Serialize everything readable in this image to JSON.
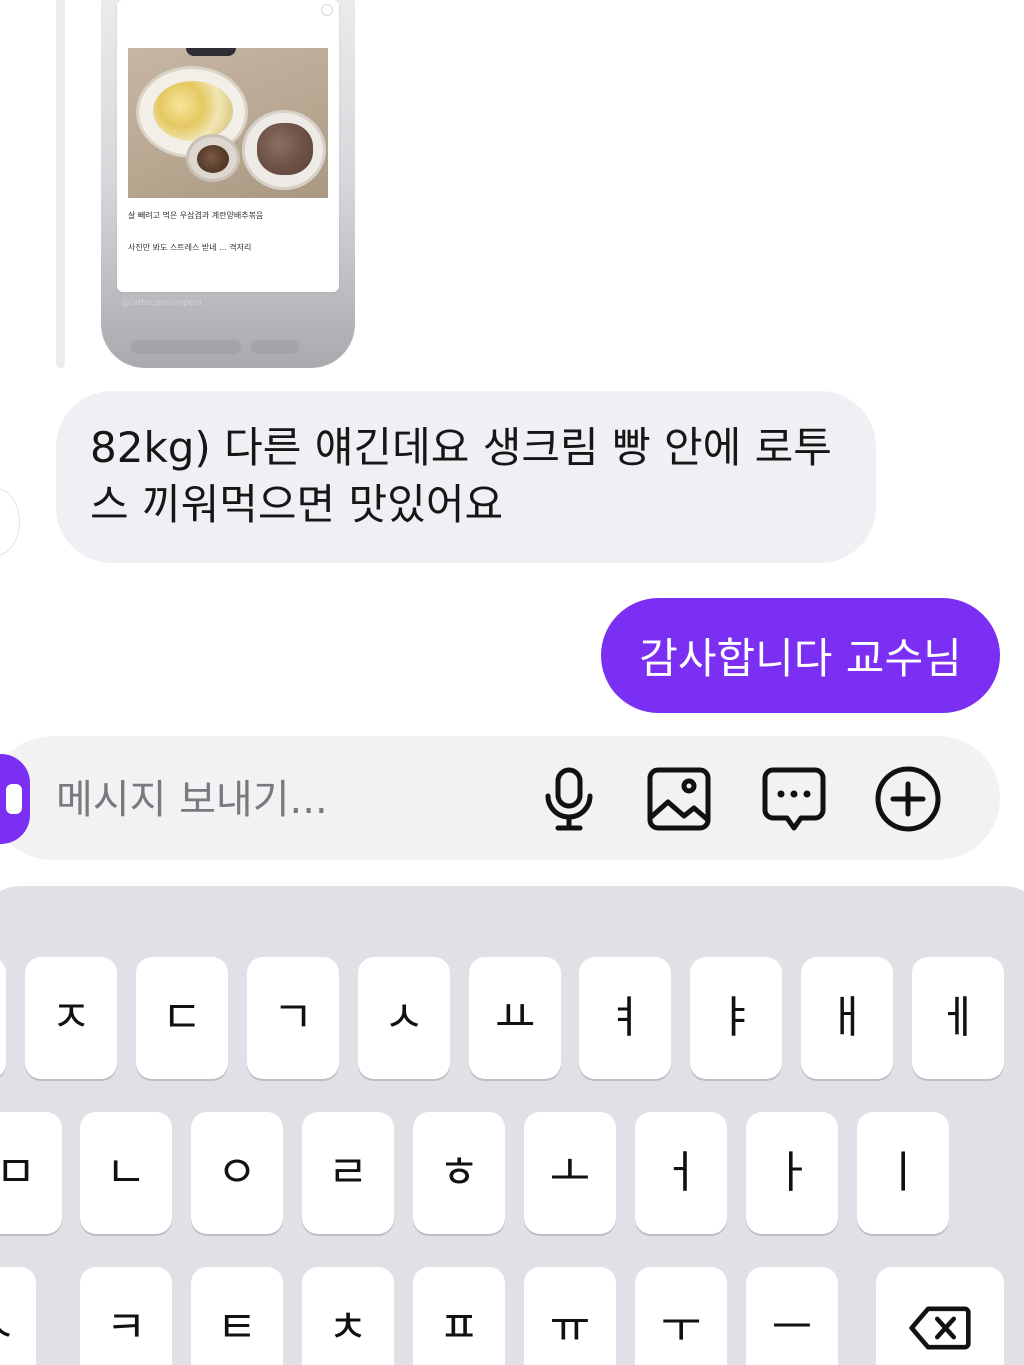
{
  "shared_post": {
    "caption_line1": "살 빼려고 먹은 우삼겹과 계란양배추볶음",
    "caption_line2": "사진만 봐도 스트레스 받네 ... 격저리",
    "handle": "@cattocopinionperd"
  },
  "messages": [
    {
      "direction": "incoming",
      "text": "82kg) 다른 얘긴데요 생크림 빵 안에 로투스 끼워먹으면 맛있어요"
    },
    {
      "direction": "outgoing",
      "text": "감사합니다 교수님"
    }
  ],
  "composer": {
    "placeholder": "메시지 보내기...",
    "icons": [
      "microphone-icon",
      "image-icon",
      "chat-bubble-icon",
      "plus-circle-icon"
    ]
  },
  "keyboard": {
    "row1": [
      "ㅈ",
      "ㄷ",
      "ㄱ",
      "ㅅ",
      "ㅛ",
      "ㅕ",
      "ㅑ",
      "ㅐ",
      "ㅔ"
    ],
    "row2": [
      "ㅁ",
      "ㄴ",
      "ㅇ",
      "ㄹ",
      "ㅎ",
      "ㅗ",
      "ㅓ",
      "ㅏ",
      "ㅣ"
    ],
    "row3": [
      "ㅋ",
      "ㅌ",
      "ㅊ",
      "ㅍ",
      "ㅠ",
      "ㅜ",
      "ㅡ"
    ],
    "row3_left_partial": "ㅅ"
  },
  "colors": {
    "accent": "#7b2ff2",
    "incoming_bubble": "#efeff4",
    "keyboard_bg": "#e0e0e6"
  }
}
